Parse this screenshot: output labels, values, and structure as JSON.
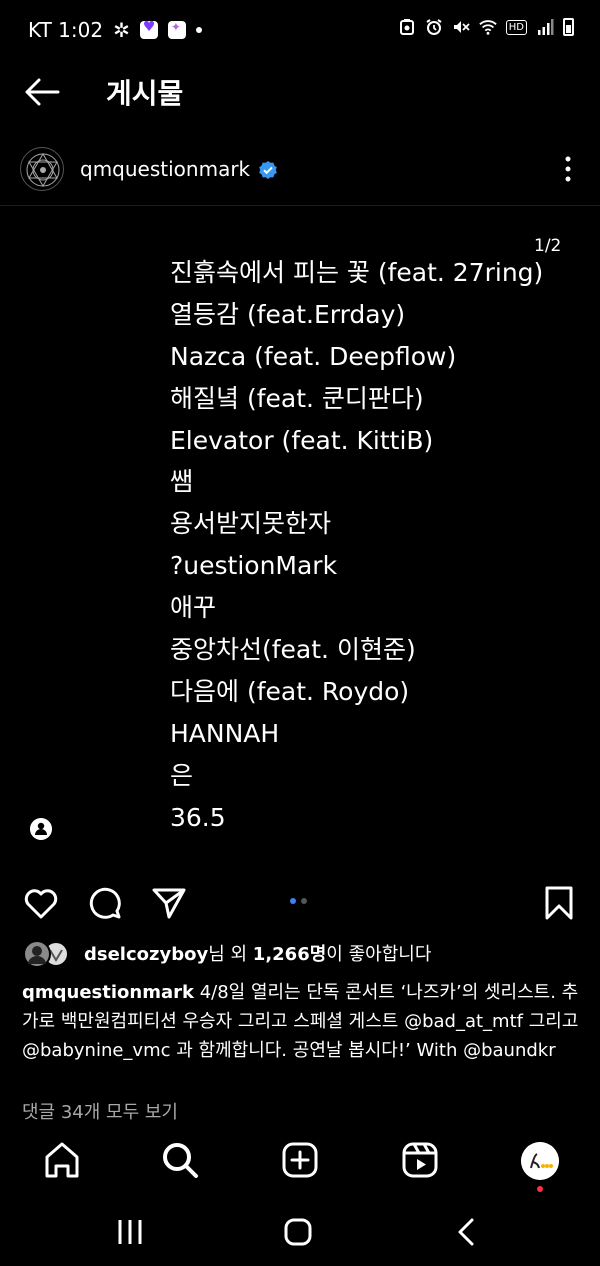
{
  "status_bar": {
    "carrier_time": "KT 1:02",
    "hd_label": "HD"
  },
  "header": {
    "title": "게시물"
  },
  "post": {
    "username": "qmquestionmark",
    "image_counter": "1/2",
    "tracklist": [
      "진흙속에서 피는 꽃 (feat. 27ring)",
      "열등감 (feat.Errday)",
      "Nazca (feat. Deepflow)",
      "해질녘 (feat. 쿤디판다)",
      "Elevator (feat. KittiB)",
      "쌤",
      "용서받지못한자",
      "?uestionMark",
      "애꾸",
      "중앙차선(feat. 이현준)",
      "다음에 (feat. Roydo)",
      "HANNAH",
      "은",
      "36.5"
    ],
    "carousel": {
      "count": 2,
      "active_index": 0
    },
    "likes": {
      "user": "dselcozyboy",
      "middle": "님 외 ",
      "count": "1,266명",
      "suffix": "이 좋아합니다"
    },
    "caption": {
      "user": "qmquestionmark",
      "text": " 4/8일 열리는 단독 콘서트 ‘나즈카’의 셋리스트. 추가로 백만원컴피티션 우승자 그리고 스페셜 게스트 @bad_at_mtf 그리고 @babynine_vmc 과 함께합니다. 공연날 봅시다!’ With @baundkr"
    },
    "comments_link": "댓글 34개 모두 보기"
  },
  "colors": {
    "background": "#000000",
    "verified_blue": "#3897f0",
    "carousel_active": "#3a82f7",
    "notification_red": "#ff3040",
    "muted_text": "#a8a8a8"
  },
  "icons": {
    "status": [
      "pinwheel-icon",
      "app-heart-icon",
      "app-cat-icon",
      "dot-icon",
      "recorder-icon",
      "alarm-icon",
      "mute-icon",
      "wifi-icon",
      "hd-icon",
      "signal-icon",
      "battery-icon"
    ],
    "header": [
      "back-arrow-icon",
      "more-options-icon",
      "verified-badge-icon"
    ],
    "actions": [
      "heart-icon",
      "comment-icon",
      "share-icon",
      "bookmark-icon"
    ],
    "nav": [
      "home-icon",
      "search-icon",
      "create-post-icon",
      "reels-icon",
      "profile-avatar"
    ],
    "system_nav": [
      "recents-icon",
      "home-circle-icon",
      "back-chevron-icon"
    ]
  }
}
